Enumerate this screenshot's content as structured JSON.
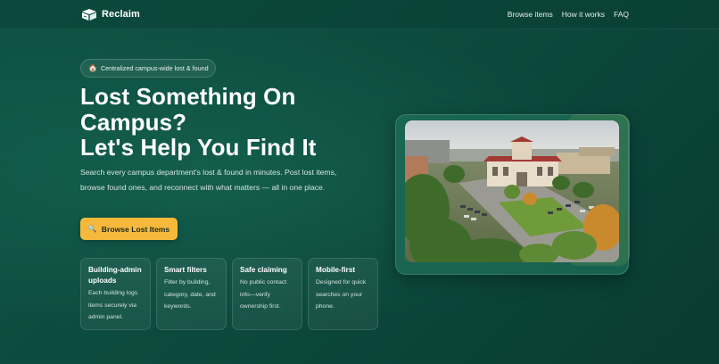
{
  "header": {
    "brand": "Reclaim",
    "nav": [
      {
        "label": "Browse items"
      },
      {
        "label": "How it works"
      },
      {
        "label": "FAQ"
      }
    ]
  },
  "badge": {
    "icon": "house-icon",
    "text": "Centralized campus-wide lost & found"
  },
  "hero": {
    "title_lines": [
      "Lost Something On",
      "Campus?",
      "Let's Help You Find It"
    ],
    "description": "Search every campus department's lost & found in minutes. Post lost items, browse found ones, and reconnect with what matters — all in one place.",
    "cta": {
      "icon": "search-icon",
      "label": "Browse Lost Items",
      "color": "#f6b93b"
    }
  },
  "features": [
    {
      "title": "Building-admin uploads",
      "desc": "Each building logs items securely via admin panel."
    },
    {
      "title": "Smart filters",
      "desc": "Filter by building, category, date, and keywords."
    },
    {
      "title": "Safe claiming",
      "desc": "No public contact info—verify ownership first."
    },
    {
      "title": "Mobile-first",
      "desc": "Designed for quick searches on your phone."
    }
  ],
  "colors": {
    "background": "#0c4a3e",
    "accent": "#f6b93b",
    "image_accent": "#6d8a3c"
  }
}
